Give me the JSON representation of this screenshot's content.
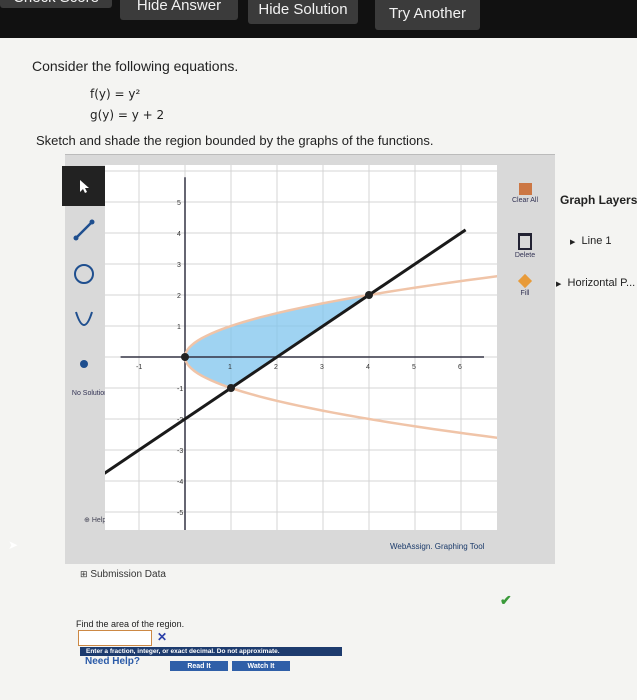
{
  "top_buttons": {
    "check_score": "Check Score",
    "hide_answer": "Hide Answer",
    "hide_solution": "Hide Solution",
    "try_another": "Try Another"
  },
  "problem": {
    "intro": "Consider the following equations.",
    "f": "f(y) = y²",
    "g": "g(y) = y + 2",
    "instruction": "Sketch and shade the region bounded by the graphs of the functions."
  },
  "graph": {
    "x_ticks": [
      "-1",
      "1",
      "2",
      "3",
      "4",
      "5",
      "6"
    ],
    "y_ticks": [
      "5",
      "4",
      "3",
      "2",
      "1",
      "-1",
      "-2",
      "-3",
      "-4",
      "-5"
    ],
    "curves": {
      "parabola": "x = y^2",
      "line": "x = y + 2"
    },
    "intersections": [
      [
        1,
        -1
      ],
      [
        4,
        2
      ]
    ],
    "region_color": "#7fc4ee"
  },
  "tools": {
    "no_solution": "No Solution",
    "help": "Help"
  },
  "side_buttons": {
    "clear_all": "Clear All",
    "delete": "Delete",
    "fill": "Fill"
  },
  "layers": {
    "title": "Graph Layers",
    "items": [
      "Line 1",
      "Horizontal P..."
    ]
  },
  "footer": {
    "brand": "WebAssign. Graphing Tool",
    "submission": "Submission Data"
  },
  "question": {
    "prompt": "Find the area of the region.",
    "answer_value": "",
    "hint": "Enter a fraction, integer, or exact decimal. Do not approximate.",
    "need_help": "Need Help?",
    "read_it": "Read It",
    "watch_it": "Watch It"
  }
}
